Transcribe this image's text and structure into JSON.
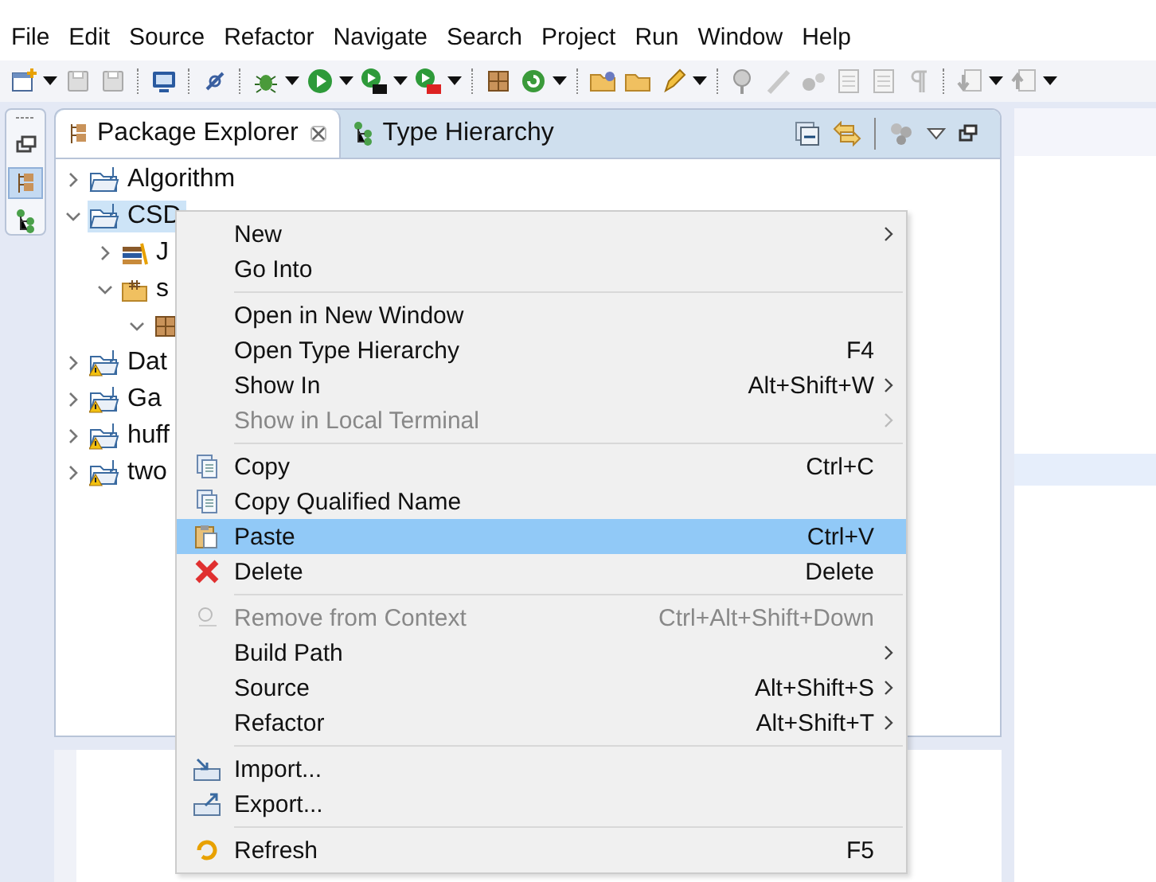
{
  "menu_bar": [
    "File",
    "Edit",
    "Source",
    "Refactor",
    "Navigate",
    "Search",
    "Project",
    "Run",
    "Window",
    "Help"
  ],
  "tabs": [
    {
      "label": "Package Explorer",
      "selected": true
    },
    {
      "label": "Type Hierarchy",
      "selected": false
    }
  ],
  "tree": [
    {
      "label": "Algorithm",
      "expanded": false,
      "selected": false,
      "warning": false
    },
    {
      "label": "CSD",
      "expanded": true,
      "selected": true,
      "warning": false,
      "children": [
        {
          "label": "J",
          "kind": "library",
          "expanded": false,
          "selected": false
        },
        {
          "label": "s",
          "kind": "source",
          "expanded": true,
          "selected": false,
          "children": [
            {
              "kind": "package",
              "expanded": true,
              "selected": false
            }
          ]
        }
      ]
    },
    {
      "label": "Dat",
      "expanded": false,
      "selected": false,
      "warning": true
    },
    {
      "label": "Ga",
      "expanded": false,
      "selected": false,
      "warning": true
    },
    {
      "label": "huff",
      "expanded": false,
      "selected": false,
      "warning": true
    },
    {
      "label": "two",
      "expanded": false,
      "selected": false,
      "warning": true
    }
  ],
  "context_menu": [
    {
      "kind": "item",
      "label": "New",
      "submenu": true,
      "disabled": false,
      "selected": false
    },
    {
      "kind": "item",
      "label": "Go Into",
      "submenu": false,
      "disabled": false,
      "selected": false
    },
    {
      "kind": "separator"
    },
    {
      "kind": "item",
      "label": "Open in New Window",
      "submenu": false,
      "disabled": false,
      "selected": false
    },
    {
      "kind": "item",
      "label": "Open Type Hierarchy",
      "shortcut": "F4",
      "submenu": false,
      "disabled": false,
      "selected": false
    },
    {
      "kind": "item",
      "label": "Show In",
      "shortcut": "Alt+Shift+W",
      "submenu": true,
      "disabled": false,
      "selected": false
    },
    {
      "kind": "item",
      "label": "Show in Local Terminal",
      "submenu": true,
      "disabled": true,
      "selected": false
    },
    {
      "kind": "separator"
    },
    {
      "kind": "item",
      "label": "Copy",
      "shortcut": "Ctrl+C",
      "submenu": false,
      "disabled": false,
      "selected": false
    },
    {
      "kind": "item",
      "label": "Copy Qualified Name",
      "submenu": false,
      "disabled": false,
      "selected": false
    },
    {
      "kind": "item",
      "label": "Paste",
      "shortcut": "Ctrl+V",
      "submenu": false,
      "disabled": false,
      "selected": true
    },
    {
      "kind": "item",
      "label": "Delete",
      "shortcut": "Delete",
      "submenu": false,
      "disabled": false,
      "selected": false
    },
    {
      "kind": "separator"
    },
    {
      "kind": "item",
      "label": "Remove from Context",
      "shortcut": "Ctrl+Alt+Shift+Down",
      "submenu": false,
      "disabled": true,
      "selected": false
    },
    {
      "kind": "item",
      "label": "Build Path",
      "submenu": true,
      "disabled": false,
      "selected": false
    },
    {
      "kind": "item",
      "label": "Source",
      "shortcut": "Alt+Shift+S",
      "submenu": true,
      "disabled": false,
      "selected": false
    },
    {
      "kind": "item",
      "label": "Refactor",
      "shortcut": "Alt+Shift+T",
      "submenu": true,
      "disabled": false,
      "selected": false
    },
    {
      "kind": "separator"
    },
    {
      "kind": "item",
      "label": "Import...",
      "submenu": false,
      "disabled": false,
      "selected": false
    },
    {
      "kind": "item",
      "label": "Export...",
      "submenu": false,
      "disabled": false,
      "selected": false
    },
    {
      "kind": "separator"
    },
    {
      "kind": "item",
      "label": "Refresh",
      "shortcut": "F5",
      "submenu": false,
      "disabled": false,
      "selected": false
    }
  ]
}
